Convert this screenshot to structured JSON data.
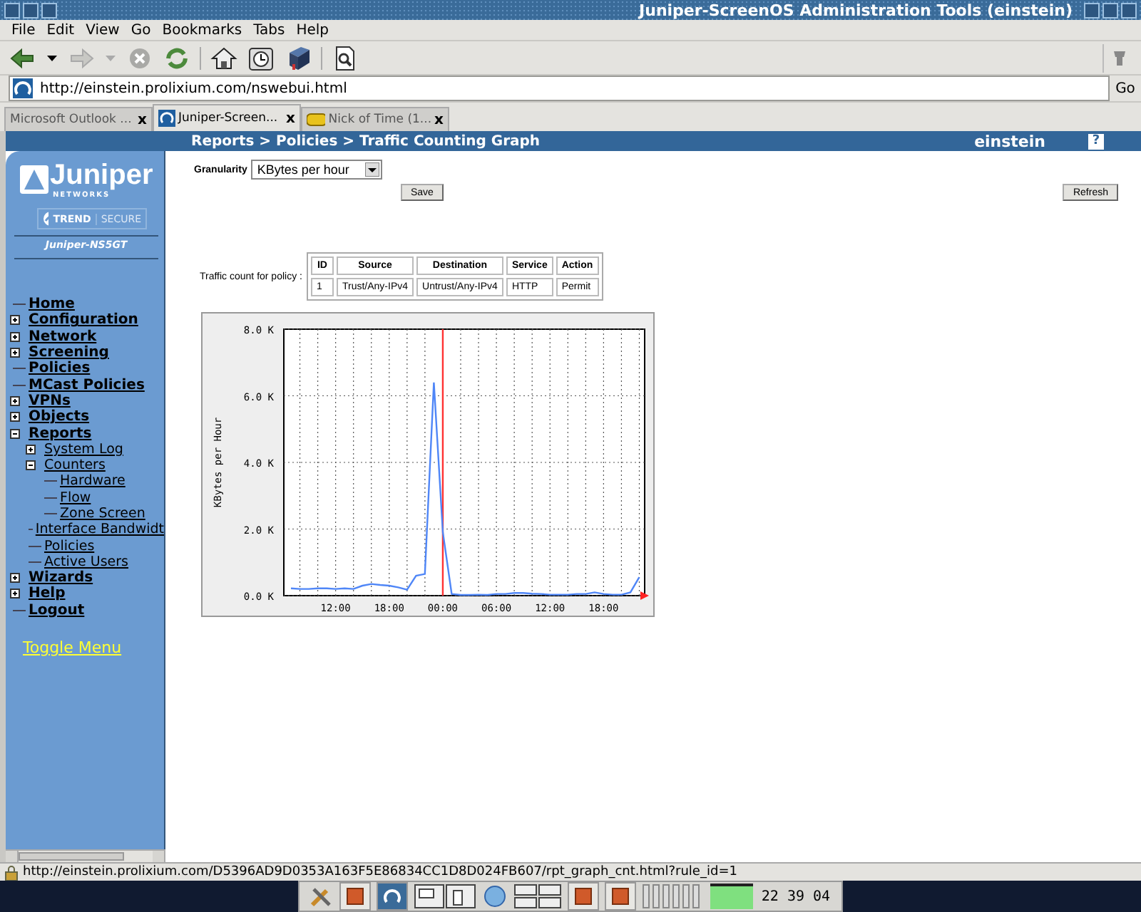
{
  "window": {
    "title": "Juniper-ScreenOS Administration Tools (einstein)"
  },
  "menu": [
    "File",
    "Edit",
    "View",
    "Go",
    "Bookmarks",
    "Tabs",
    "Help"
  ],
  "address_bar": {
    "value": "http://einstein.prolixium.com/nswebui.html",
    "go": "Go"
  },
  "tabs": [
    {
      "label": "Microsoft Outlook ...",
      "selected": false,
      "close": "x"
    },
    {
      "label": "Juniper-Screen...",
      "selected": true,
      "close": "x"
    },
    {
      "label": "Nick of Time (1...",
      "selected": false,
      "close": "x"
    }
  ],
  "header": {
    "breadcrumb": "Reports > Policies > Traffic Counting Graph",
    "device": "einstein",
    "help": "?"
  },
  "sidebar": {
    "logo": "Juniper",
    "logo_sub": "NETWORKS",
    "partner": "TREND",
    "partner_sub": "SECURE",
    "model": "Juniper-NS5GT",
    "items": [
      {
        "label": "Home",
        "kind": "link"
      },
      {
        "label": "Configuration",
        "kind": "folder",
        "expanded": false
      },
      {
        "label": "Network",
        "kind": "folder",
        "expanded": false
      },
      {
        "label": "Screening",
        "kind": "folder",
        "expanded": false
      },
      {
        "label": "Policies",
        "kind": "link"
      },
      {
        "label": "MCast Policies",
        "kind": "link"
      },
      {
        "label": "VPNs",
        "kind": "folder",
        "expanded": false
      },
      {
        "label": "Objects",
        "kind": "folder",
        "expanded": false
      },
      {
        "label": "Reports",
        "kind": "folder",
        "expanded": true,
        "children": [
          {
            "label": "System Log",
            "kind": "folder",
            "expanded": false
          },
          {
            "label": "Counters",
            "kind": "folder",
            "expanded": true,
            "children": [
              {
                "label": "Hardware",
                "kind": "link"
              },
              {
                "label": "Flow",
                "kind": "link"
              },
              {
                "label": "Zone Screen",
                "kind": "link"
              }
            ]
          },
          {
            "label": "Interface Bandwidt",
            "kind": "link"
          },
          {
            "label": "Policies",
            "kind": "link"
          },
          {
            "label": "Active Users",
            "kind": "link"
          }
        ]
      },
      {
        "label": "Wizards",
        "kind": "folder",
        "expanded": false
      },
      {
        "label": "Help",
        "kind": "folder",
        "expanded": false
      },
      {
        "label": "Logout",
        "kind": "link"
      }
    ],
    "toggle": "Toggle Menu"
  },
  "granularity": {
    "label": "Granularity",
    "value": "KBytes per hour"
  },
  "buttons": {
    "save": "Save",
    "refresh": "Refresh"
  },
  "policy": {
    "label": "Traffic count for policy :",
    "columns": [
      "ID",
      "Source",
      "Destination",
      "Service",
      "Action"
    ],
    "rows": [
      [
        "1",
        "Trust/Any-IPv4",
        "Untrust/Any-IPv4",
        "HTTP",
        "Permit"
      ]
    ]
  },
  "chart_data": {
    "type": "line",
    "ylabel": "KBytes per Hour",
    "grid": true,
    "xlim": [
      "2000-01-01T06:12",
      "2000-01-02T22:36"
    ],
    "ylim": [
      0,
      8000
    ],
    "xticks": [
      {
        "value": "2000-01-01T12:00",
        "label": "12:00"
      },
      {
        "value": "2000-01-01T18:00",
        "label": "18:00"
      },
      {
        "value": "2000-01-02T00:00",
        "label": "00:00"
      },
      {
        "value": "2000-01-02T06:00",
        "label": "06:00"
      },
      {
        "value": "2000-01-02T12:00",
        "label": "12:00"
      },
      {
        "value": "2000-01-02T18:00",
        "label": "18:00"
      }
    ],
    "yticks": [
      {
        "value": 0,
        "label": "0.0 K"
      },
      {
        "value": 2000,
        "label": "2.0 K"
      },
      {
        "value": 4000,
        "label": "4.0 K"
      },
      {
        "value": 6000,
        "label": "6.0 K"
      },
      {
        "value": 8000,
        "label": "8.0 K"
      }
    ],
    "x": [
      "2000-01-01T07:00",
      "2000-01-01T08:00",
      "2000-01-01T09:00",
      "2000-01-01T10:00",
      "2000-01-01T11:00",
      "2000-01-01T12:00",
      "2000-01-01T13:00",
      "2000-01-01T14:00",
      "2000-01-01T15:00",
      "2000-01-01T16:00",
      "2000-01-01T17:00",
      "2000-01-01T18:00",
      "2000-01-01T19:00",
      "2000-01-01T20:00",
      "2000-01-01T21:00",
      "2000-01-01T22:00",
      "2000-01-01T23:00",
      "2000-01-02T00:00",
      "2000-01-02T01:00",
      "2000-01-02T02:00",
      "2000-01-02T03:00",
      "2000-01-02T04:00",
      "2000-01-02T05:00",
      "2000-01-02T06:00",
      "2000-01-02T07:00",
      "2000-01-02T08:00",
      "2000-01-02T09:00",
      "2000-01-02T10:00",
      "2000-01-02T11:00",
      "2000-01-02T12:00",
      "2000-01-02T13:00",
      "2000-01-02T14:00",
      "2000-01-02T15:00",
      "2000-01-02T16:00",
      "2000-01-02T17:00",
      "2000-01-02T18:00",
      "2000-01-02T19:00",
      "2000-01-02T20:00",
      "2000-01-02T21:00",
      "2000-01-02T22:00"
    ],
    "values": [
      220,
      200,
      200,
      220,
      220,
      200,
      220,
      200,
      300,
      350,
      320,
      300,
      250,
      180,
      600,
      650,
      6400,
      1900,
      50,
      20,
      20,
      30,
      20,
      50,
      50,
      80,
      80,
      60,
      50,
      30,
      30,
      30,
      50,
      50,
      100,
      50,
      30,
      30,
      100,
      550
    ],
    "ref_lines": [
      {
        "axis": "x",
        "value": "2000-01-02T00:00",
        "color": "#ff3333"
      }
    ]
  },
  "status_bar": {
    "url": "http://einstein.prolixium.com/D5396AD9D0353A163F5E86834CC1D8D024FB607/rpt_graph_cnt.html?rule_id=1"
  },
  "taskbar": {
    "clock": "22 39 04"
  }
}
